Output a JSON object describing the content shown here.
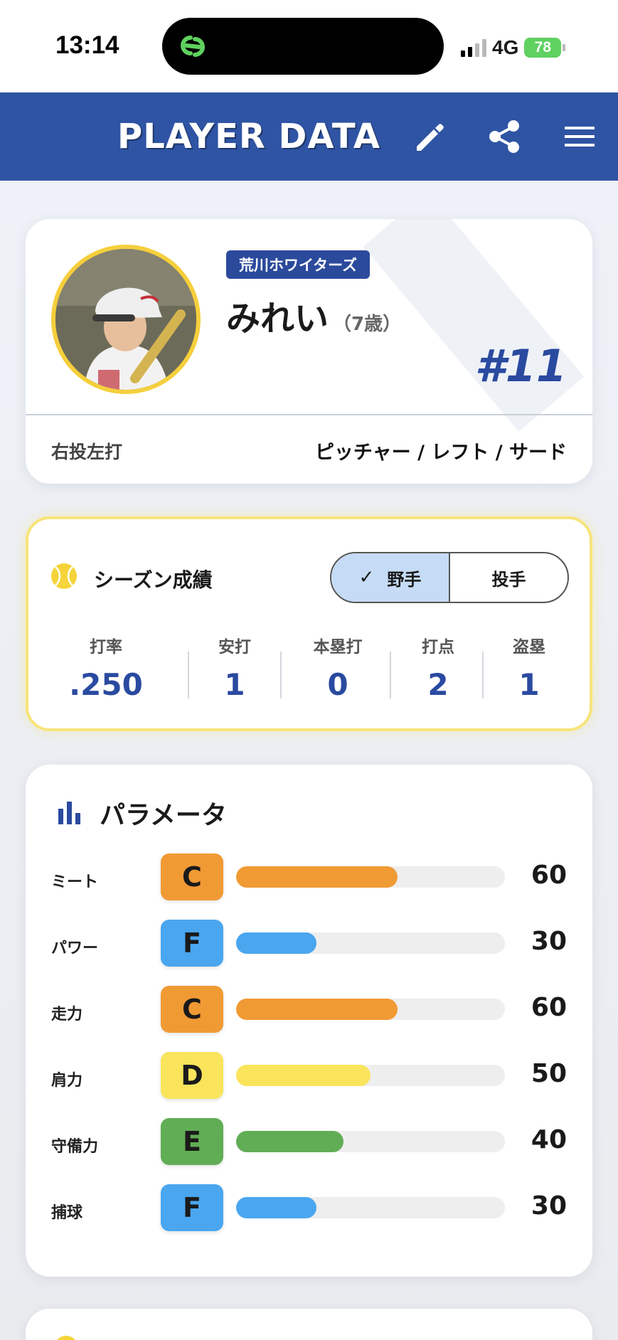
{
  "status_bar": {
    "time": "13:14",
    "network": "4G",
    "battery": "78"
  },
  "header": {
    "title": "PLAYER DATA",
    "edit_icon": "pencil-icon",
    "share_icon": "share-icon",
    "menu_icon": "hamburger-menu-icon",
    "background_color": "#2f54a4"
  },
  "profile": {
    "team": "荒川ホワイターズ",
    "name": "みれい",
    "age": "（7歳）",
    "number": "#11",
    "throw_bat": "右投左打",
    "positions": "ピッチャー / レフト / サード",
    "number_color": "#2a4aa0"
  },
  "season": {
    "title": "シーズン成績",
    "tabs": [
      {
        "label": "野手",
        "active": true
      },
      {
        "label": "投手",
        "active": false
      }
    ],
    "stats": [
      {
        "label": "打率",
        "value": ".250"
      },
      {
        "label": "安打",
        "value": "1"
      },
      {
        "label": "本塁打",
        "value": "0"
      },
      {
        "label": "打点",
        "value": "2"
      },
      {
        "label": "盗塁",
        "value": "1"
      }
    ]
  },
  "params": {
    "title": "パラメータ",
    "items": [
      {
        "label": "ミート",
        "grade": "C",
        "value": "60",
        "level": 0.6,
        "color": "#f09a34"
      },
      {
        "label": "パワー",
        "grade": "F",
        "value": "30",
        "level": 0.3,
        "color": "#4aa6ef"
      },
      {
        "label": "走力",
        "grade": "C",
        "value": "60",
        "level": 0.6,
        "color": "#f09a34"
      },
      {
        "label": "肩力",
        "grade": "D",
        "value": "50",
        "level": 0.5,
        "color": "#f9e45c"
      },
      {
        "label": "守備力",
        "grade": "E",
        "value": "40",
        "level": 0.4,
        "color": "#61ad55"
      },
      {
        "label": "捕球",
        "grade": "F",
        "value": "30",
        "level": 0.3,
        "color": "#4aa6ef"
      }
    ]
  }
}
